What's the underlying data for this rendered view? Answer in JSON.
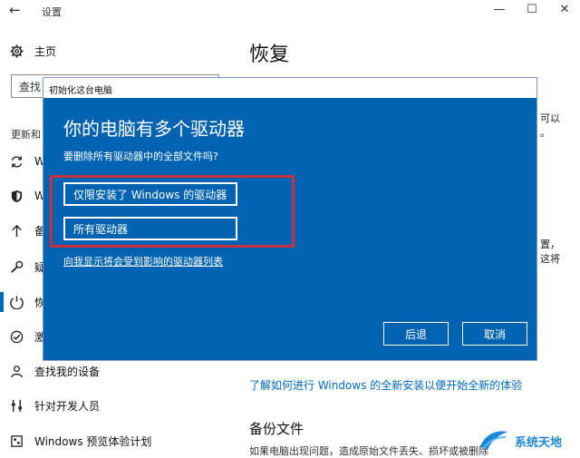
{
  "window": {
    "title": "设置",
    "back_glyph": "←",
    "controls": [
      "—",
      "☐",
      "✕"
    ]
  },
  "sidebar": {
    "home_label": "主页",
    "search_text": "查找",
    "section_label": "更新和",
    "items": [
      {
        "label": "W",
        "icon": "sync-icon"
      },
      {
        "label": "W",
        "icon": "shield-icon"
      },
      {
        "label": "备",
        "icon": "upload-arrow-icon"
      },
      {
        "label": "疑",
        "icon": "wrench-icon"
      },
      {
        "label": "恢",
        "icon": "recovery-icon"
      },
      {
        "label": "激",
        "icon": "check-circle-icon"
      },
      {
        "label": "查找我的设备",
        "icon": "person-pin-icon"
      },
      {
        "label": "针对开发人员",
        "icon": "developer-icon"
      },
      {
        "label": "Windows 预览体验计划",
        "icon": "insider-icon"
      }
    ]
  },
  "main": {
    "title": "恢复",
    "fragments": [
      "可以",
      "。",
      "置，",
      "这将"
    ],
    "link": "了解如何进行 Windows 的全新安装以便开始全新的体验",
    "backup_title": "备份文件",
    "backup_desc": "如果电脑出现问题，造成原始文件丢失、损坏或被删除"
  },
  "dialog": {
    "title": "初始化这台电脑",
    "heading": "你的电脑有多个驱动器",
    "question": "要删除所有驱动器中的全部文件吗?",
    "option_windows_drive": "仅限安装了 Windows 的驱动器",
    "option_all_drives": "所有驱动器",
    "show_list_link": "向我显示将会受到影响的驱动器列表",
    "back_label": "后退",
    "cancel_label": "取消"
  },
  "watermark": {
    "text": "系统天地"
  },
  "colors": {
    "dialog_bg": "#0063b1",
    "accent": "#0067c0",
    "highlight": "#c9303f"
  }
}
